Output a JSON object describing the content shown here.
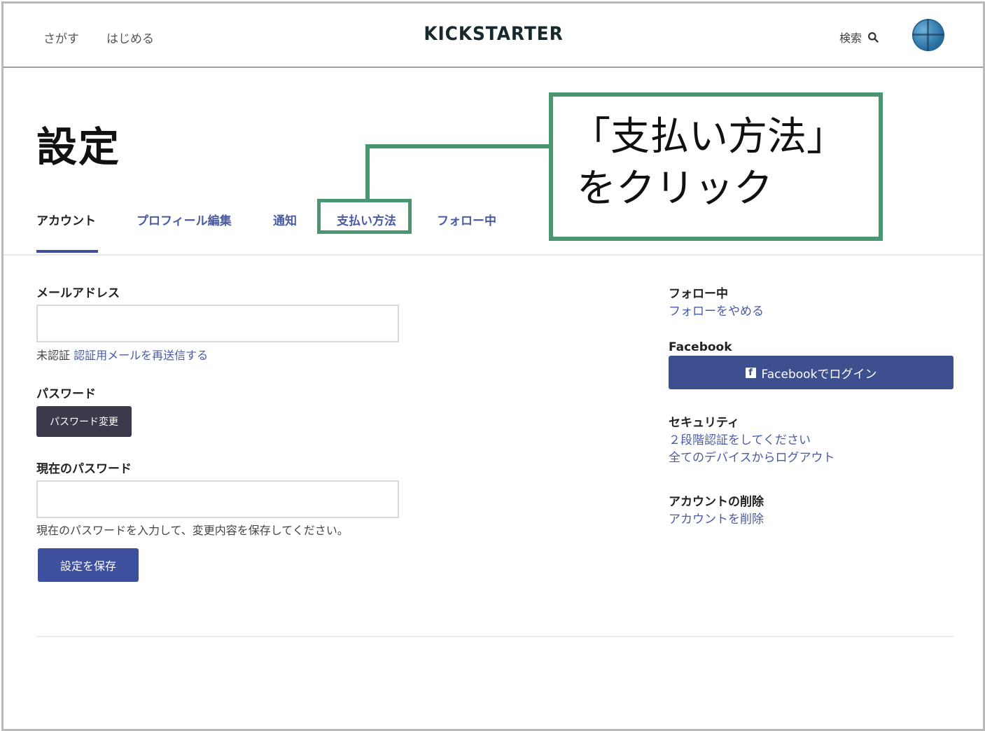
{
  "header": {
    "nav": [
      "さがす",
      "はじめる"
    ],
    "logo": "KICKSTARTER",
    "search_label": "検索"
  },
  "page": {
    "title": "設定"
  },
  "tabs": [
    {
      "label": "アカウント",
      "active": true
    },
    {
      "label": "プロフィール編集",
      "active": false
    },
    {
      "label": "通知",
      "active": false
    },
    {
      "label": "支払い方法",
      "active": false
    },
    {
      "label": "フォロー中",
      "active": false
    }
  ],
  "callout": {
    "line1": "「支払い方法」",
    "line2": "をクリック",
    "color": "#4a9672"
  },
  "form": {
    "email_label": "メールアドレス",
    "email_value": "",
    "unverified_text": "未認証",
    "resend_link": "認証用メールを再送信する",
    "password_label": "パスワード",
    "change_password_button": "パスワード変更",
    "current_password_label": "現在のパスワード",
    "current_password_value": "",
    "current_password_hint": "現在のパスワードを入力して、変更内容を保存してください。",
    "save_button": "設定を保存"
  },
  "sidebar": {
    "following_heading": "フォロー中",
    "unfollow_link": "フォローをやめる",
    "facebook_heading": "Facebook",
    "facebook_button": "Facebookでログイン",
    "security_heading": "セキュリティ",
    "two_factor_link": "２段階認証をしてください",
    "logout_all_link": "全てのデバイスからログアウト",
    "delete_heading": "アカウントの削除",
    "delete_link": "アカウントを削除"
  },
  "colors": {
    "accent": "#3e4f9e",
    "link": "#4a5ba4",
    "highlight": "#4a9672"
  }
}
